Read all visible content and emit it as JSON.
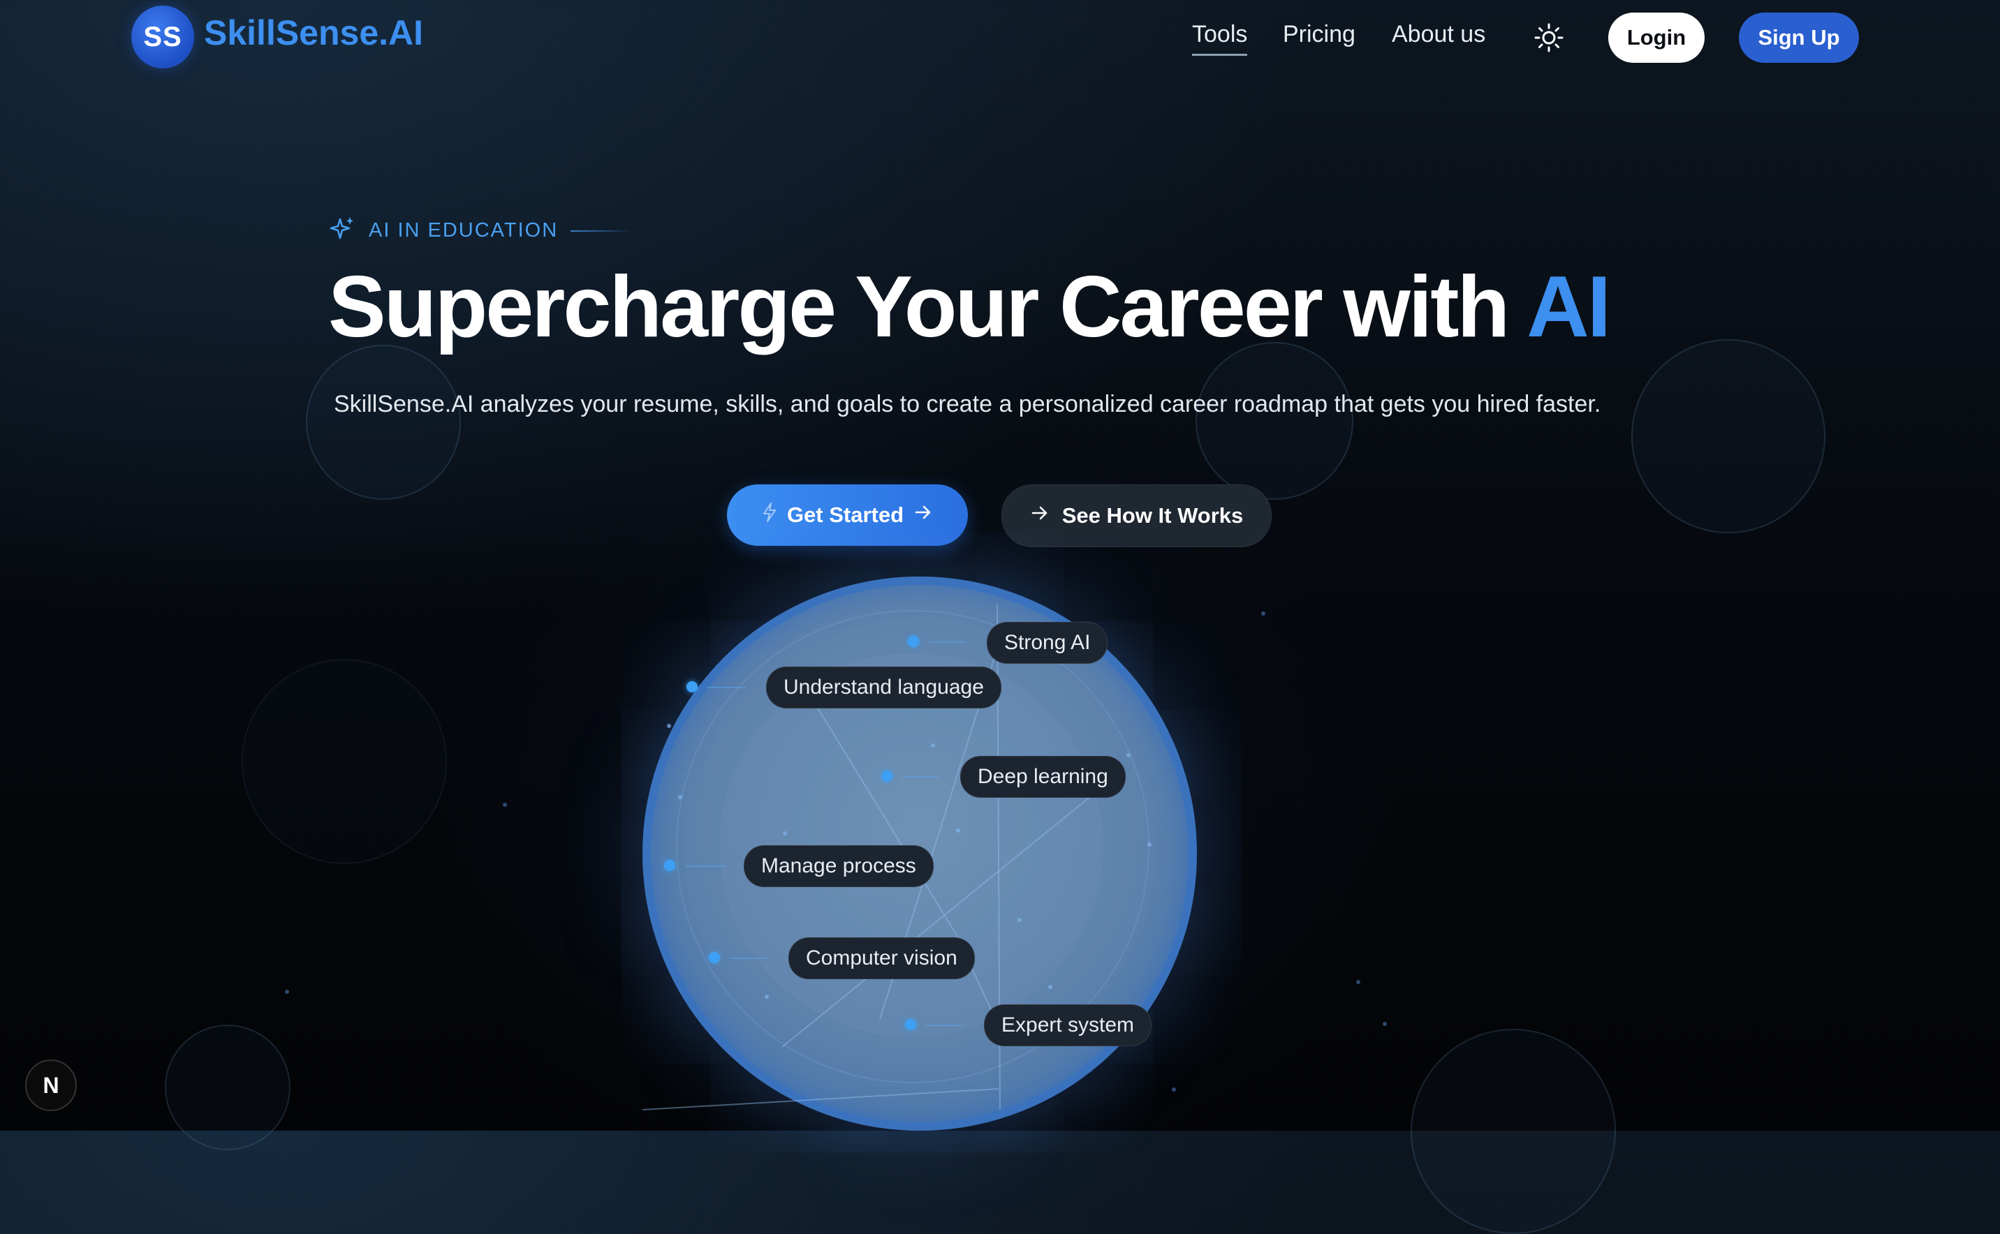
{
  "brand": {
    "badge": "SS",
    "name": "SkillSense.AI",
    "accent": "#3d8ff0"
  },
  "nav": {
    "links": [
      {
        "label": "Tools",
        "active": true
      },
      {
        "label": "Pricing",
        "active": false
      },
      {
        "label": "About us",
        "active": false
      }
    ],
    "theme_icon": "sun-icon",
    "login_label": "Login",
    "signup_label": "Sign Up"
  },
  "hero": {
    "eyebrow": "AI IN EDUCATION",
    "eyebrow_icon": "sparkles-icon",
    "headline_main": "Supercharge Your Career with ",
    "headline_accent": "AI",
    "subtext": "SkillSense.AI analyzes your resume, skills, and goals to create a personalized career roadmap that gets you hired faster.",
    "cta_primary": "Get Started",
    "cta_primary_icons": [
      "bolt-icon",
      "arrow-right-icon"
    ],
    "cta_secondary": "See How It Works",
    "cta_secondary_icon": "arrow-right-icon"
  },
  "sphere_tags": [
    "Strong AI",
    "Understand language",
    "Deep learning",
    "Manage process",
    "Computer vision",
    "Expert system"
  ],
  "dev_badge": "N"
}
